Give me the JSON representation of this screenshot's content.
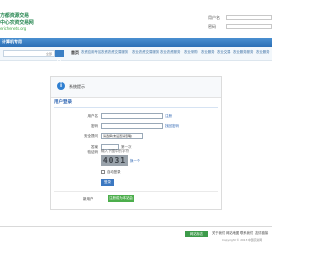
{
  "header": {
    "logo_lines": [
      "方都资源交易",
      "中心农资交易网",
      "erichenets.org"
    ],
    "logo_partial": "erichenets.org",
    "label_top": "用户名",
    "label_bottom": "密码"
  },
  "band": {
    "title": "计算机专用"
  },
  "nav": {
    "search_select": "全部",
    "home": "首页",
    "links": [
      "农资应用专区",
      "农资农资交易服务",
      "农业农资交易服务",
      "农业农资服务",
      "农业采购",
      "农业服务",
      "农业交易",
      "农业服务服务",
      "农业服务"
    ]
  },
  "panel": {
    "title": "系统提示",
    "section_title": "用户登录",
    "username_label": "用户名",
    "username_suffix": "注册",
    "password_label": "密码",
    "password_hint": "找回密码",
    "security_label": "安全提问",
    "security_value": "请选择(未设置请忽略)",
    "answer_label": "答案",
    "answer_hint": "第一次",
    "captcha_label": "验证码",
    "captcha_instruction": "输入下图中的字符",
    "captcha_text": "4031",
    "captcha_link": "换一个",
    "remember_label": "自动登录",
    "login_button": "登录",
    "reg_label": "新用户",
    "reg_button": "注册成为本站会员"
  },
  "footer": {
    "badge": "网站标志",
    "links": [
      "关于我们",
      "网站地图",
      "联系我们",
      "友情链接"
    ],
    "line1": "Copyright © 2013",
    "line2": "中国农资网"
  },
  "colors": {
    "band": "#2c6fb5",
    "accent": "#2f66b3",
    "logo": "#2e8b57",
    "register": "#4cae4c"
  }
}
